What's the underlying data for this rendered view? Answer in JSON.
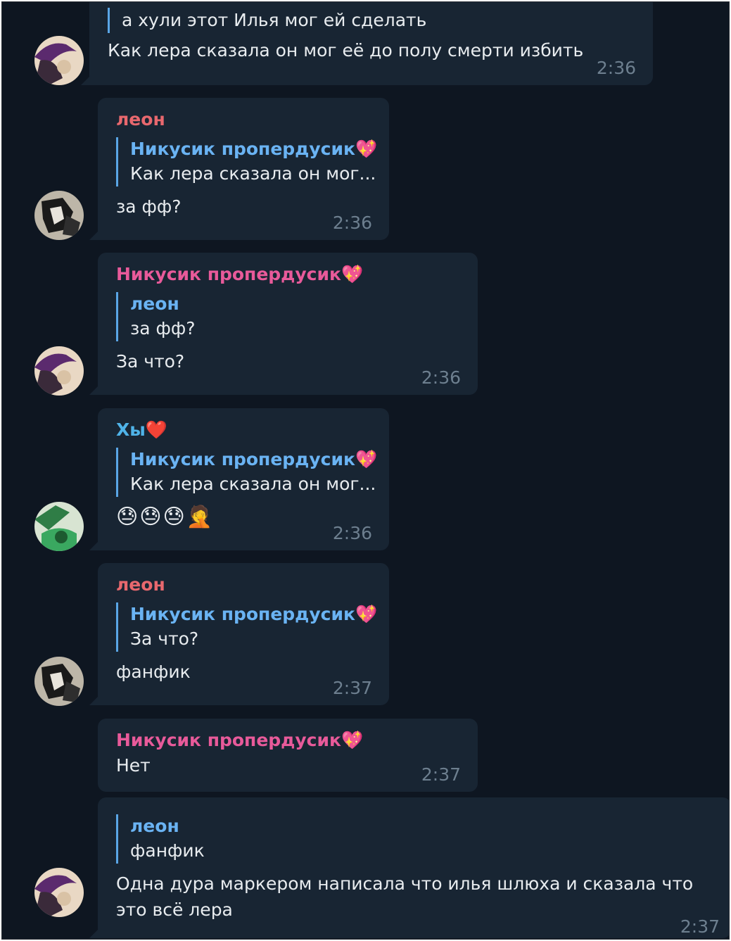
{
  "messages": [
    {
      "reply_text": "а хули этот Илья мог ей сделать",
      "text": "Как лера сказала он мог её до полу смерти избить",
      "time": "2:36"
    },
    {
      "sender": "леон",
      "reply_name": "Никусик пропердусик💖",
      "reply_text": "Как лера сказала он мог...",
      "text": "за фф?",
      "time": "2:36"
    },
    {
      "sender": "Никусик пропердусик💖",
      "reply_name": "леон",
      "reply_text": "за фф?",
      "text": "За что?",
      "time": "2:36"
    },
    {
      "sender": "Хы❤️",
      "reply_name": "Никусик пропердусик💖",
      "reply_text": "Как лера сказала он мог...",
      "text": "😓😓😓🤦",
      "time": "2:36"
    },
    {
      "sender": "леон",
      "reply_name": "Никусик пропердусик💖",
      "reply_text": "За что?",
      "text": "фанфик",
      "time": "2:37"
    },
    {
      "sender": "Никусик пропердусик💖",
      "text": "Нет",
      "time": "2:37"
    },
    {
      "reply_name": "леон",
      "reply_text": "фанфик",
      "text_line1": "Одна дура маркером написала что илья шлюха и сказала что",
      "text_line2": "это всё лера",
      "time": "2:37"
    }
  ],
  "colors": {
    "background": "#0e1621",
    "bubble": "#182533",
    "sender_leon": "#e8686e",
    "sender_nikusik": "#e85a9a",
    "sender_hy": "#4fb3e8",
    "reply_name": "#6ab3f3",
    "time": "#6d7f8f"
  },
  "icons": {
    "avatar_nikusik": "purple-hat-anime-avatar",
    "avatar_leon": "black-white-anime-avatar",
    "avatar_hy": "green-anime-avatar"
  }
}
